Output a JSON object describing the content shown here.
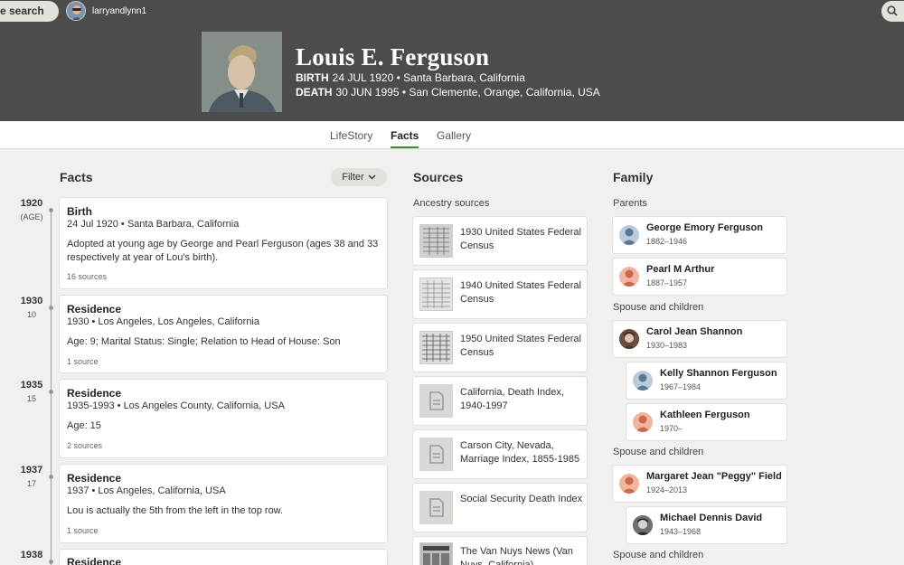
{
  "topbar": {
    "search_label": "e search",
    "username": "larryandlynn1"
  },
  "person": {
    "name": "Louis E. Ferguson",
    "birth_label": "BIRTH",
    "birth_value": "24 JUL 1920 • Santa Barbara, California",
    "death_label": "DEATH",
    "death_value": "30 JUN 1995 • San Clemente, Orange, California, USA"
  },
  "tabs": [
    {
      "label": "LifeStory",
      "active": false
    },
    {
      "label": "Facts",
      "active": true
    },
    {
      "label": "Gallery",
      "active": false
    }
  ],
  "facts": {
    "title": "Facts",
    "filter_label": "Filter",
    "timeline": [
      {
        "year": "1920",
        "age": "(AGE)"
      },
      {
        "year": "1930",
        "age": "10"
      },
      {
        "year": "1935",
        "age": "15"
      },
      {
        "year": "1937",
        "age": "17"
      },
      {
        "year": "1938",
        "age": ""
      }
    ],
    "cards": [
      {
        "title": "Birth",
        "detail": "24 Jul 1920 • Santa Barbara, California",
        "note": "Adopted at young age by George and Pearl Ferguson (ages 38 and 33 respectively at year of Lou's birth).",
        "sources": "16 sources"
      },
      {
        "title": "Residence",
        "detail": "1930 • Los Angeles, Los Angeles, California",
        "note": "Age: 9; Marital Status: Single; Relation to Head of House: Son",
        "sources": "1 source"
      },
      {
        "title": "Residence",
        "detail": "1935-1993 • Los Angeles County, California, USA",
        "note": "Age: 15",
        "sources": "2 sources"
      },
      {
        "title": "Residence",
        "detail": "1937 • Los Angeles, California, USA",
        "note": "Lou is actually the 5th from the left in the top row.",
        "sources": "1 source"
      },
      {
        "title": "Residence",
        "detail": "",
        "note": "",
        "sources": ""
      }
    ]
  },
  "sources": {
    "title": "Sources",
    "subtitle": "Ancestry sources",
    "items": [
      {
        "label": "1930 United States Federal Census",
        "icon": "census-image"
      },
      {
        "label": "1940 United States Federal Census",
        "icon": "census-image"
      },
      {
        "label": "1950 United States Federal Census",
        "icon": "census-image"
      },
      {
        "label": "California, Death Index, 1940-1997",
        "icon": "document-icon"
      },
      {
        "label": "Carson City, Nevada, Marriage Index, 1855-1985",
        "icon": "document-icon"
      },
      {
        "label": "Social Security Death Index",
        "icon": "document-icon"
      },
      {
        "label": "The Van Nuys News (Van Nuys, California)",
        "icon": "newspaper-image"
      }
    ]
  },
  "family": {
    "title": "Family",
    "parents_label": "Parents",
    "spouse_label_1": "Spouse and children",
    "spouse_label_2": "Spouse and children",
    "spouse_label_3": "Spouse and children",
    "members": [
      {
        "name": "George Emory Ferguson",
        "dates": "1882–1946",
        "avatar": "male-silhouette"
      },
      {
        "name": "Pearl M Arthur",
        "dates": "1887–1957",
        "avatar": "female-silhouette"
      },
      {
        "name": "Carol Jean Shannon",
        "dates": "1930–1983",
        "avatar": "photo"
      },
      {
        "name": "Kelly Shannon Ferguson",
        "dates": "1967–1984",
        "avatar": "male-silhouette"
      },
      {
        "name": "Kathleen Ferguson",
        "dates": "1970–",
        "avatar": "female-silhouette"
      },
      {
        "name": "Margaret Jean \"Peggy\" Field",
        "dates": "1924–2013",
        "avatar": "female-silhouette"
      },
      {
        "name": "Michael Dennis David",
        "dates": "1943–1968",
        "avatar": "photo"
      }
    ]
  },
  "colors": {
    "header_bg": "#4c4c4c",
    "page_bg": "#f1f0ee",
    "tab_active_underline": "#3d8a27",
    "male_avatar_bg": "#b9cbdc",
    "female_avatar_bg": "#f1b49e"
  }
}
